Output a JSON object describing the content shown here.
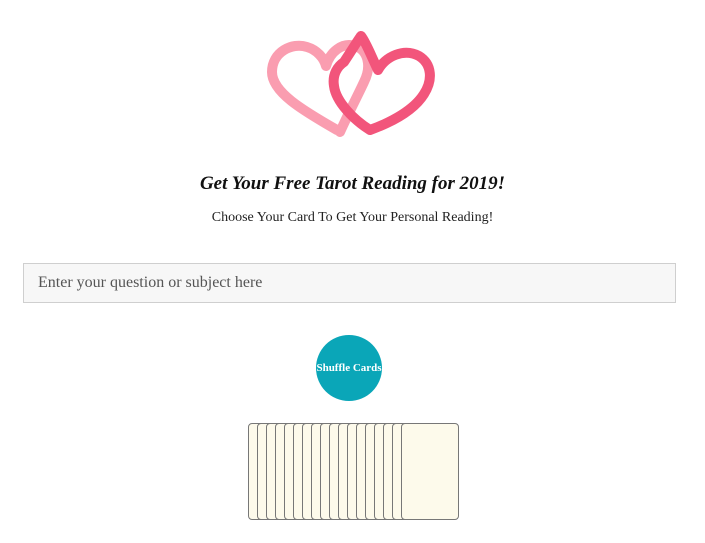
{
  "header": {
    "logo": "two-interlocking-hearts-logo",
    "title": "Get Your Free Tarot Reading for 2019!",
    "subtitle": "Choose Your Card To Get Your Personal Reading!"
  },
  "question": {
    "value": "",
    "placeholder": "Enter your question or subject here"
  },
  "shuffle": {
    "label": "Shuffle Cards"
  },
  "deck": {
    "card_count": 18
  },
  "colors": {
    "heart_left": "#fa9db0",
    "heart_right": "#f2557b",
    "button": "#0aa6b8",
    "card_face": "#fdfaeb",
    "card_border": "#777777"
  }
}
